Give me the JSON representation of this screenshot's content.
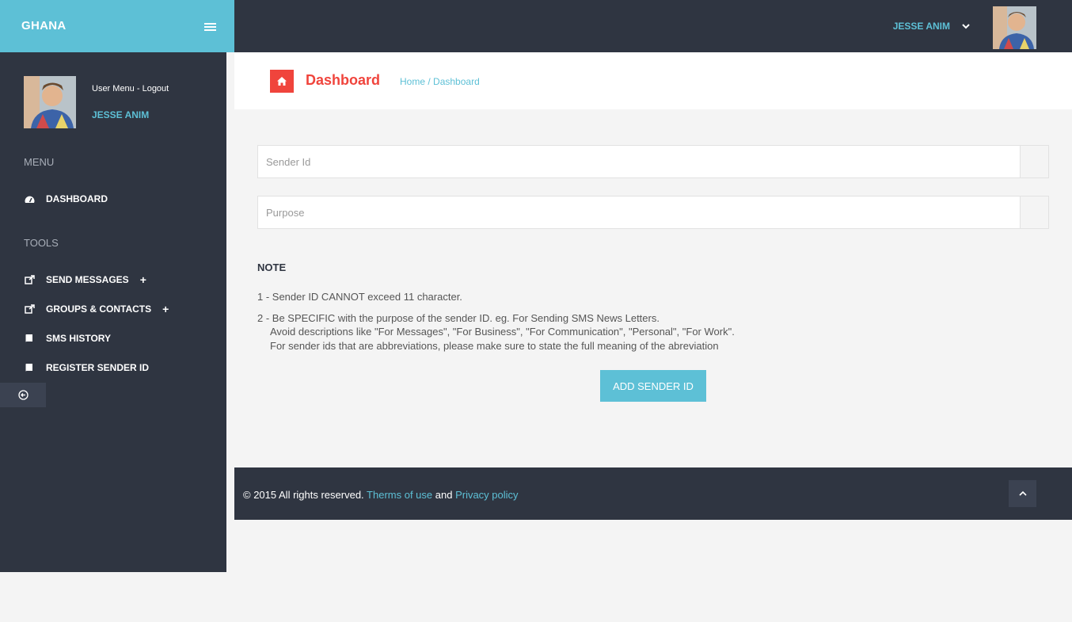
{
  "brand": {
    "name": "GHANA"
  },
  "topbar": {
    "user_name": "JESSE ANIM"
  },
  "sidebar": {
    "user_menu_label": "User Menu",
    "user_menu_sep": " - ",
    "logout_label": "Logout",
    "user_name": "JESSE ANIM",
    "menu_title": "MENU",
    "tools_title": "TOOLS",
    "items": [
      {
        "label": "DASHBOARD",
        "icon": "dashboard-icon"
      },
      {
        "label": "SEND MESSAGES",
        "icon": "share-icon",
        "plus": "+"
      },
      {
        "label": "GROUPS & CONTACTS",
        "icon": "share-icon",
        "plus": "+"
      },
      {
        "label": "SMS HISTORY",
        "icon": "book-icon"
      },
      {
        "label": "REGISTER SENDER ID",
        "icon": "book-icon"
      }
    ]
  },
  "header": {
    "title": "Dashboard",
    "breadcrumb_home": "Home",
    "breadcrumb_sep": " / ",
    "breadcrumb_current": "Dashboard"
  },
  "form": {
    "sender_id_placeholder": "Sender Id",
    "purpose_placeholder": "Purpose",
    "submit_label": "ADD SENDER ID"
  },
  "note": {
    "title": "NOTE",
    "line1": "1 - Sender ID CANNOT exceed 11 character.",
    "line2": "2 - Be SPECIFIC with the purpose of the sender ID. eg. For Sending SMS News Letters.",
    "line3": "Avoid descriptions like \"For Messages\", \"For Business\", \"For Communication\", \"Personal\", \"For Work\".",
    "line4": "For sender ids that are abbreviations, please make sure to state the full meaning of the abreviation"
  },
  "footer": {
    "copyright": "© 2015 All rights reserved. ",
    "terms_label": "Therms of use",
    "and_text": " and ",
    "privacy_label": "Privacy policy"
  },
  "colors": {
    "accent": "#5dc0d6",
    "dark": "#2f3541",
    "danger": "#f0443c"
  }
}
